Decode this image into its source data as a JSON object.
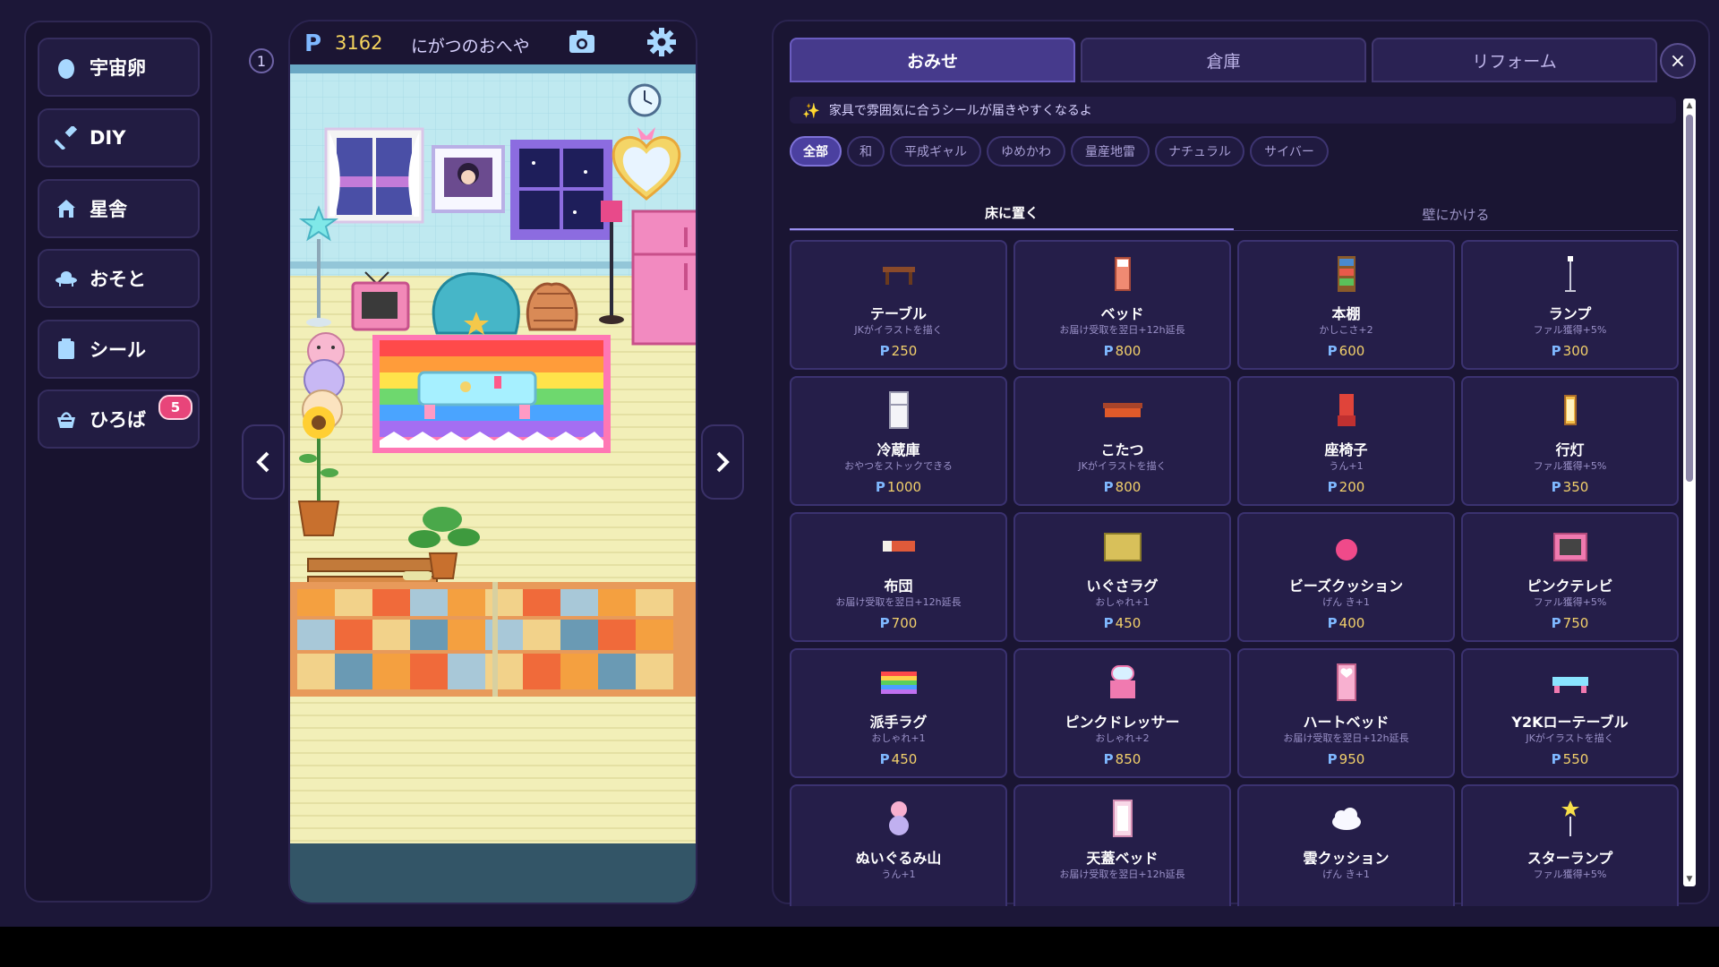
{
  "sidebar": {
    "items": [
      {
        "label": "宇宙卵",
        "icon": "egg-icon"
      },
      {
        "label": "DIY",
        "icon": "hammer-icon"
      },
      {
        "label": "星舎",
        "icon": "house-icon"
      },
      {
        "label": "おそと",
        "icon": "ufo-icon"
      },
      {
        "label": "シール",
        "icon": "sticker-icon"
      },
      {
        "label": "ひろば",
        "icon": "basket-icon",
        "badge": "5"
      }
    ]
  },
  "page_indicator": "1",
  "room": {
    "coin_symbol": "P",
    "points": "3162",
    "name": "にがつのおへや"
  },
  "shop": {
    "tabs": [
      "おみせ",
      "倉庫",
      "リフォーム"
    ],
    "active_tab": 0,
    "close_label": "×",
    "hint": "家具で雰囲気に合うシールが届きやすくなるよ",
    "filters": [
      "全部",
      "和",
      "平成ギャル",
      "ゆめかわ",
      "量産地雷",
      "ナチュラル",
      "サイバー"
    ],
    "active_filter": 0,
    "subtabs": [
      "床に置く",
      "壁にかける"
    ],
    "active_subtab": 0,
    "items": [
      {
        "name": "テーブル",
        "desc": "JKがイラストを描く",
        "price": "250",
        "icon": "table-icon"
      },
      {
        "name": "ベッド",
        "desc": "お届け受取を翌日+12h延長",
        "price": "800",
        "icon": "bed-icon"
      },
      {
        "name": "本棚",
        "desc": "かしこさ+2",
        "price": "600",
        "icon": "bookshelf-icon"
      },
      {
        "name": "ランプ",
        "desc": "ファル獲得+5%",
        "price": "300",
        "icon": "lamp-icon"
      },
      {
        "name": "冷蔵庫",
        "desc": "おやつをストックできる",
        "price": "1000",
        "icon": "fridge-icon"
      },
      {
        "name": "こたつ",
        "desc": "JKがイラストを描く",
        "price": "800",
        "icon": "kotatsu-icon"
      },
      {
        "name": "座椅子",
        "desc": "うん+1",
        "price": "200",
        "icon": "floor-chair-icon"
      },
      {
        "name": "行灯",
        "desc": "ファル獲得+5%",
        "price": "350",
        "icon": "andon-lantern-icon"
      },
      {
        "name": "布団",
        "desc": "お届け受取を翌日+12h延長",
        "price": "700",
        "icon": "futon-icon"
      },
      {
        "name": "いぐさラグ",
        "desc": "おしゃれ+1",
        "price": "450",
        "icon": "igusa-rug-icon"
      },
      {
        "name": "ビーズクッション",
        "desc": "げん き+1",
        "price": "400",
        "icon": "bead-cushion-icon"
      },
      {
        "name": "ピンクテレビ",
        "desc": "ファル獲得+5%",
        "price": "750",
        "icon": "pink-tv-icon"
      },
      {
        "name": "派手ラグ",
        "desc": "おしゃれ+1",
        "price": "450",
        "icon": "flashy-rug-icon"
      },
      {
        "name": "ピンクドレッサー",
        "desc": "おしゃれ+2",
        "price": "850",
        "icon": "pink-dresser-icon"
      },
      {
        "name": "ハートベッド",
        "desc": "お届け受取を翌日+12h延長",
        "price": "950",
        "icon": "heart-bed-icon"
      },
      {
        "name": "Y2Kローテーブル",
        "desc": "JKがイラストを描く",
        "price": "550",
        "icon": "y2k-low-table-icon"
      },
      {
        "name": "ぬいぐるみ山",
        "desc": "うん+1",
        "price": "",
        "icon": "plush-pile-icon"
      },
      {
        "name": "天蓋ベッド",
        "desc": "お届け受取を翌日+12h延長",
        "price": "",
        "icon": "canopy-bed-icon"
      },
      {
        "name": "雲クッション",
        "desc": "げん き+1",
        "price": "",
        "icon": "cloud-cushion-icon"
      },
      {
        "name": "スターランプ",
        "desc": "ファル獲得+5%",
        "price": "",
        "icon": "star-lamp-icon"
      }
    ]
  },
  "colors": {
    "background": "#1c1738",
    "panel": "#1a1533",
    "card": "#251e49",
    "accent": "#463a8c",
    "price": "#f2d06b",
    "coin": "#7fb8ff",
    "badge": "#e8457a"
  }
}
